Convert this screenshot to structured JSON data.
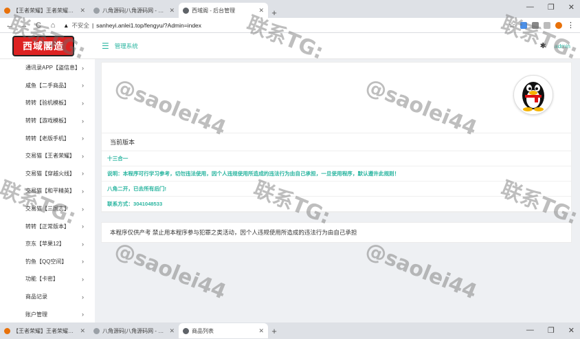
{
  "browser": {
    "tabs": [
      {
        "label": "【王者荣耀】王者荣耀账号_8|彩…",
        "color": "#e8710a"
      },
      {
        "label": "八角源码|八角源码网 - 打造国内…",
        "color": "#9aa0a6"
      },
      {
        "label": "西域阁 - 后台管理",
        "color": "#5f6368",
        "active": true
      }
    ],
    "bottom_tabs": [
      {
        "label": "【王者荣耀】王者荣耀账号_8|彩…",
        "color": "#e8710a"
      },
      {
        "label": "八角源码|八角源码网 - 打造国内…",
        "color": "#9aa0a6"
      },
      {
        "label": "商品列表",
        "color": "#5f6368",
        "active": true
      }
    ],
    "new_tab": "+",
    "window_controls": [
      "—",
      "❐",
      "✕"
    ],
    "nav": {
      "back": "←",
      "forward": "→",
      "reload": "C",
      "home": "⌂"
    },
    "insecure_label": "不安全",
    "url": "sanheyi.anlei1.top/fengyu/?Admin=index",
    "star": "☆",
    "menu": "⋮"
  },
  "header": {
    "logo_text": "西域閣造",
    "menu_toggle": "☰",
    "system_title": "管理系统",
    "puzzle": "✱",
    "user": "admin"
  },
  "sidebar": {
    "items": [
      {
        "label": "通讯录APP【盗信息】"
      },
      {
        "label": "咸鱼【二手商品】"
      },
      {
        "label": "转转【验机模板】"
      },
      {
        "label": "转转【游戏模板】"
      },
      {
        "label": "转转【老版手机】"
      },
      {
        "label": "交易猫【王者荣耀】"
      },
      {
        "label": "交易猫【穿越火线】"
      },
      {
        "label": "交易猫【和平精英】"
      },
      {
        "label": "交易猫【三国志】"
      },
      {
        "label": "转转【正常版本】"
      },
      {
        "label": "京东【苹果12】"
      },
      {
        "label": "钓鱼【QQ空间】"
      },
      {
        "label": "功能【卡密】"
      },
      {
        "label": "商品记录"
      },
      {
        "label": "账户管理"
      }
    ],
    "chevron": "›"
  },
  "main": {
    "version_title": "当前版本",
    "lines": [
      "十三合一",
      "说明：本程序可行学习参考，切勿违法使用，因个人违规使用所造成的违法行为由自己承担，一旦使用程序，默认遵许此规则！",
      "八角二开，已去所有后门!",
      "联系方式：3041048533"
    ],
    "disclaimer": "本程序仅供产考 禁止用本程序参与犯罪之类活动，因个人违规使用所造成的违法行为由自己承担"
  },
  "watermarks": {
    "tg": "联系TG:",
    "handle": "@saolei44"
  },
  "colors": {
    "accent": "#2ab5a0",
    "logo": "#dd2222"
  }
}
